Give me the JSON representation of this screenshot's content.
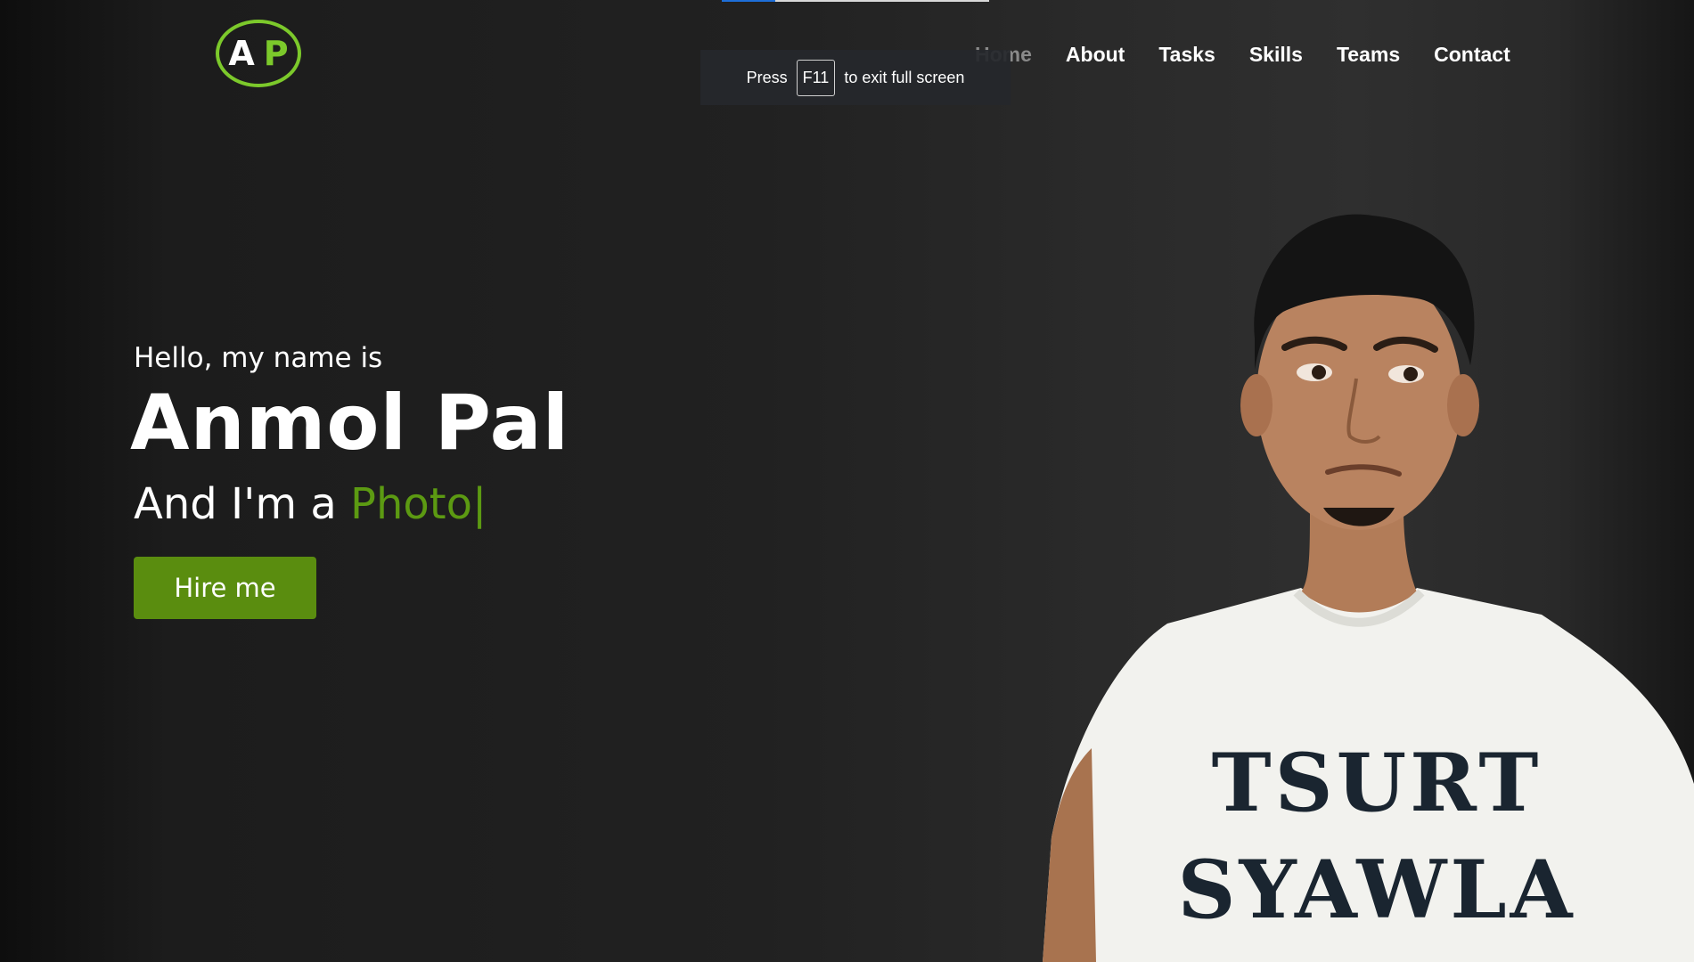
{
  "logo": {
    "letter1": "A",
    "letter2": "P"
  },
  "nav": {
    "items": [
      {
        "label": "Home"
      },
      {
        "label": "About"
      },
      {
        "label": "Tasks"
      },
      {
        "label": "Skills"
      },
      {
        "label": "Teams"
      },
      {
        "label": "Contact"
      }
    ]
  },
  "fullscreen_toast": {
    "press": "Press",
    "key": "F11",
    "suffix": "to exit full screen"
  },
  "hero": {
    "greeting": "Hello, my name is",
    "name": "Anmol Pal",
    "role_prefix": "And I'm a",
    "role_typed": "Photo",
    "cursor": "|",
    "button_label": "Hire me"
  },
  "portrait": {
    "shirt_line1": "TSURT",
    "shirt_line2": "SYAWLA"
  },
  "colors": {
    "accent": "#5c9a12",
    "logo_ring": "#7cc92b",
    "button": "#5a8d0f"
  }
}
